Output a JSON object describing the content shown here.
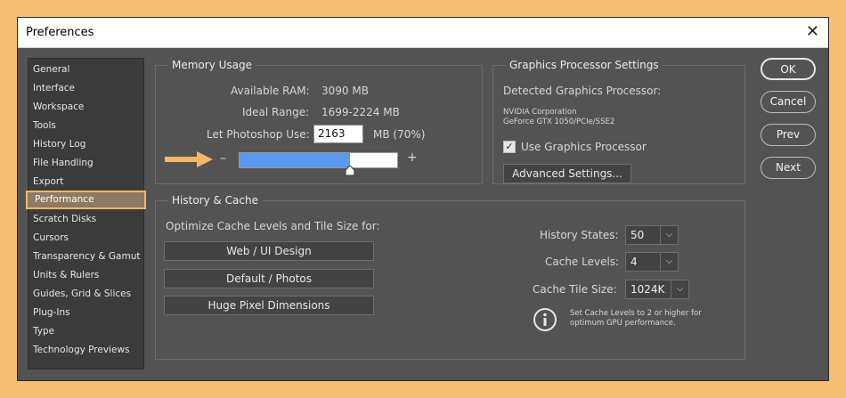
{
  "window": {
    "title": "Preferences",
    "close_glyph": "✕"
  },
  "sidebar": {
    "items": [
      {
        "label": "General"
      },
      {
        "label": "Interface"
      },
      {
        "label": "Workspace"
      },
      {
        "label": "Tools"
      },
      {
        "label": "History Log"
      },
      {
        "label": "File Handling"
      },
      {
        "label": "Export"
      },
      {
        "label": "Performance",
        "active": true
      },
      {
        "label": "Scratch Disks"
      },
      {
        "label": "Cursors"
      },
      {
        "label": "Transparency & Gamut"
      },
      {
        "label": "Units & Rulers"
      },
      {
        "label": "Guides, Grid & Slices"
      },
      {
        "label": "Plug-Ins"
      },
      {
        "label": "Type"
      },
      {
        "label": "Technology Previews"
      }
    ]
  },
  "memory": {
    "legend": "Memory Usage",
    "available_label": "Available RAM:",
    "available_value": "3090 MB",
    "ideal_label": "Ideal Range:",
    "ideal_value": "1699-2224 MB",
    "let_label": "Let Photoshop Use:",
    "let_value": "2163",
    "let_suffix": "MB (70%)",
    "minus": "–",
    "plus": "+",
    "slider_fraction": 0.7
  },
  "gpu": {
    "legend": "Graphics Processor Settings",
    "detected_label": "Detected Graphics Processor:",
    "vendor": "NVIDIA Corporation",
    "model": "GeForce GTX 1050/PCIe/SSE2",
    "use_label": "Use Graphics Processor",
    "use_checked": true,
    "advanced_label": "Advanced Settings..."
  },
  "history": {
    "legend": "History & Cache",
    "optimize_label": "Optimize Cache Levels and Tile Size for:",
    "buttons": [
      "Web / UI Design",
      "Default / Photos",
      "Huge Pixel Dimensions"
    ],
    "states_label": "History States:",
    "states_value": "50",
    "cache_levels_label": "Cache Levels:",
    "cache_levels_value": "4",
    "tile_label": "Cache Tile Size:",
    "tile_value": "1024K",
    "info_line1": "Set Cache Levels to 2 or higher for",
    "info_line2": "optimum GPU performance."
  },
  "actions": {
    "ok": "OK",
    "cancel": "Cancel",
    "prev": "Prev",
    "next": "Next"
  },
  "colors": {
    "background": "#f7bf73",
    "panel": "#535353",
    "slider_fill": "#5c97f0",
    "highlight": "#f6b665",
    "arrow": "#f6b665"
  }
}
